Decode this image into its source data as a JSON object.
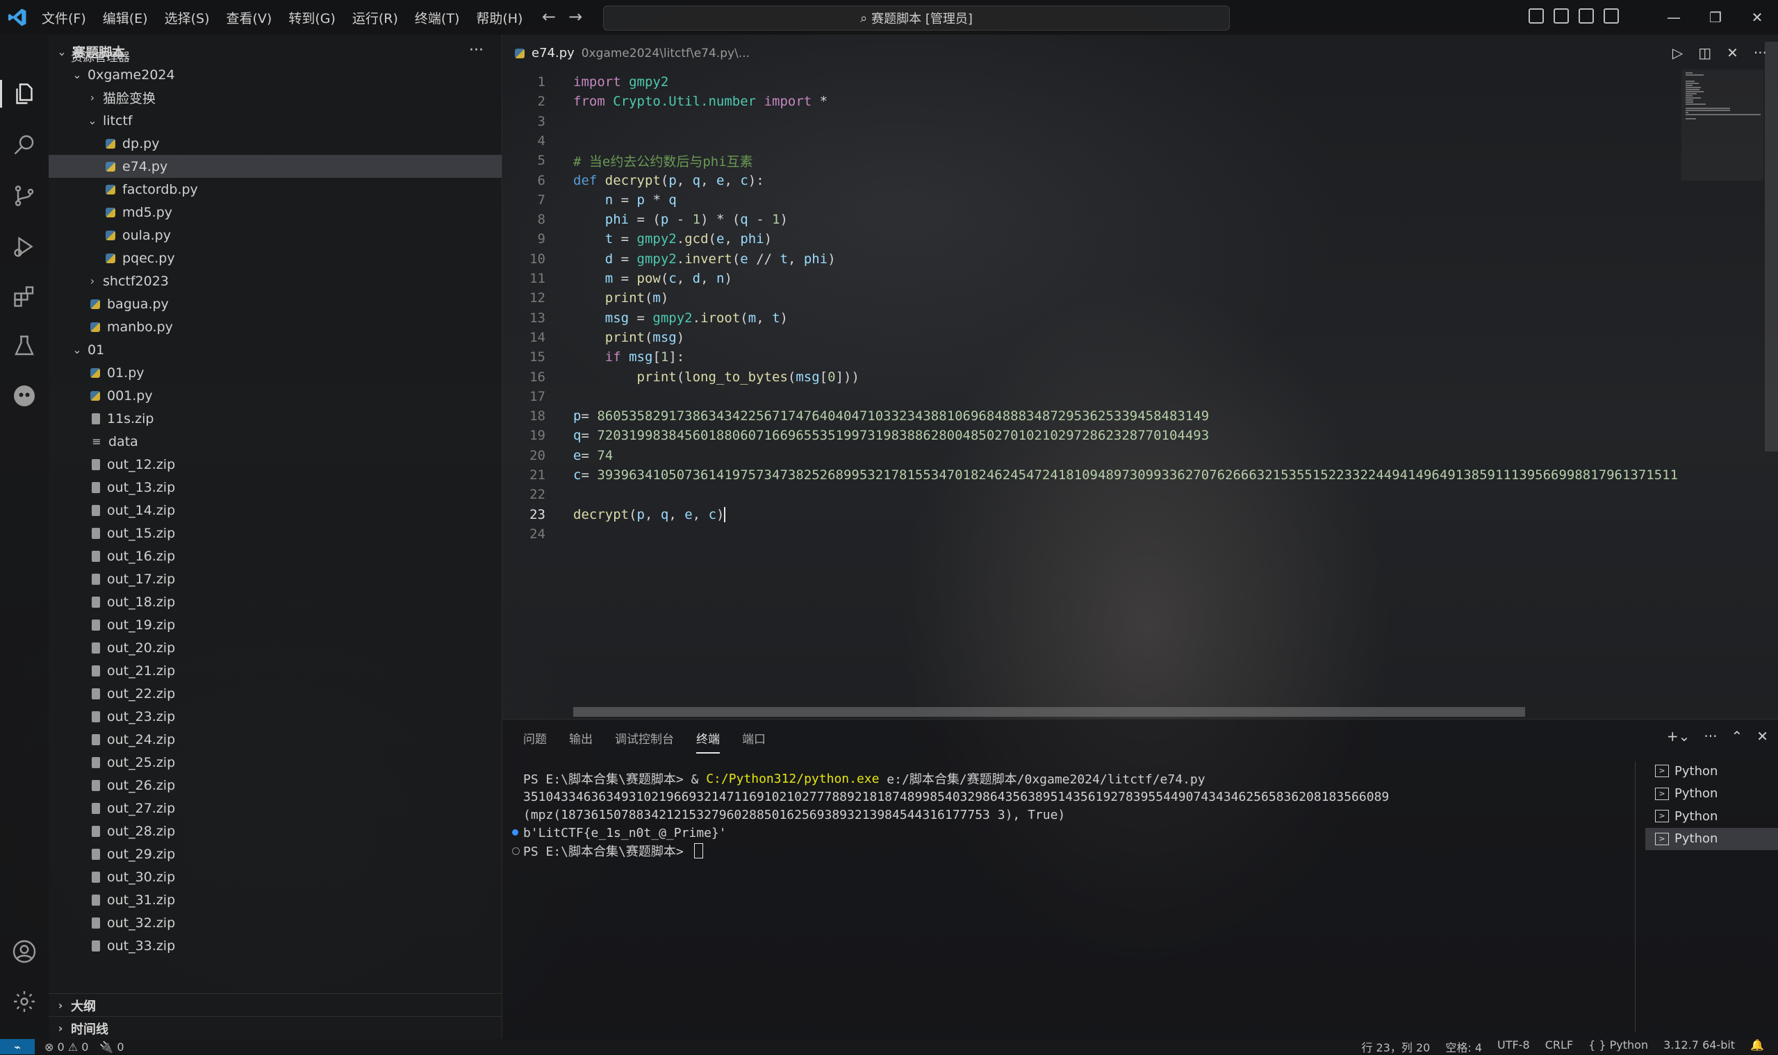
{
  "window": {
    "command_center": "赛题脚本 [管理员]"
  },
  "menu": [
    "文件(F)",
    "编辑(E)",
    "选择(S)",
    "查看(V)",
    "转到(G)",
    "运行(R)",
    "终端(T)",
    "帮助(H)"
  ],
  "sidebar": {
    "title": "资源管理器",
    "more": "···",
    "tree": [
      {
        "label": "赛题脚本",
        "level": 0,
        "type": "folder-open",
        "bold": true
      },
      {
        "label": "0xgame2024",
        "level": 1,
        "type": "folder-open"
      },
      {
        "label": "猫脸变换",
        "level": 2,
        "type": "folder-closed"
      },
      {
        "label": "litctf",
        "level": 2,
        "type": "folder-open"
      },
      {
        "label": "dp.py",
        "level": 3,
        "type": "py"
      },
      {
        "label": "e74.py",
        "level": 3,
        "type": "py",
        "selected": true
      },
      {
        "label": "factordb.py",
        "level": 3,
        "type": "py"
      },
      {
        "label": "md5.py",
        "level": 3,
        "type": "py"
      },
      {
        "label": "oula.py",
        "level": 3,
        "type": "py"
      },
      {
        "label": "pqec.py",
        "level": 3,
        "type": "py"
      },
      {
        "label": "shctf2023",
        "level": 2,
        "type": "folder-closed"
      },
      {
        "label": "bagua.py",
        "level": 2,
        "type": "py"
      },
      {
        "label": "manbo.py",
        "level": 2,
        "type": "py"
      },
      {
        "label": "01",
        "level": 1,
        "type": "folder-open"
      },
      {
        "label": "01.py",
        "level": 2,
        "type": "py"
      },
      {
        "label": "001.py",
        "level": 2,
        "type": "py"
      },
      {
        "label": "11s.zip",
        "level": 2,
        "type": "zip"
      },
      {
        "label": "data",
        "level": 2,
        "type": "txt"
      },
      {
        "label": "out_12.zip",
        "level": 2,
        "type": "zip"
      },
      {
        "label": "out_13.zip",
        "level": 2,
        "type": "zip"
      },
      {
        "label": "out_14.zip",
        "level": 2,
        "type": "zip"
      },
      {
        "label": "out_15.zip",
        "level": 2,
        "type": "zip"
      },
      {
        "label": "out_16.zip",
        "level": 2,
        "type": "zip"
      },
      {
        "label": "out_17.zip",
        "level": 2,
        "type": "zip"
      },
      {
        "label": "out_18.zip",
        "level": 2,
        "type": "zip"
      },
      {
        "label": "out_19.zip",
        "level": 2,
        "type": "zip"
      },
      {
        "label": "out_20.zip",
        "level": 2,
        "type": "zip"
      },
      {
        "label": "out_21.zip",
        "level": 2,
        "type": "zip"
      },
      {
        "label": "out_22.zip",
        "level": 2,
        "type": "zip"
      },
      {
        "label": "out_23.zip",
        "level": 2,
        "type": "zip"
      },
      {
        "label": "out_24.zip",
        "level": 2,
        "type": "zip"
      },
      {
        "label": "out_25.zip",
        "level": 2,
        "type": "zip"
      },
      {
        "label": "out_26.zip",
        "level": 2,
        "type": "zip"
      },
      {
        "label": "out_27.zip",
        "level": 2,
        "type": "zip"
      },
      {
        "label": "out_28.zip",
        "level": 2,
        "type": "zip"
      },
      {
        "label": "out_29.zip",
        "level": 2,
        "type": "zip"
      },
      {
        "label": "out_30.zip",
        "level": 2,
        "type": "zip"
      },
      {
        "label": "out_31.zip",
        "level": 2,
        "type": "zip"
      },
      {
        "label": "out_32.zip",
        "level": 2,
        "type": "zip"
      },
      {
        "label": "out_33.zip",
        "level": 2,
        "type": "zip"
      }
    ],
    "outline": "大纲",
    "timeline": "时间线"
  },
  "editor": {
    "tab_name": "e74.py",
    "tab_path": "0xgame2024\\litctf\\e74.py\\...",
    "current_line": 23,
    "lines": [
      [
        [
          "kw",
          "import"
        ],
        [
          "pl",
          " "
        ],
        [
          "mod",
          "gmpy2"
        ]
      ],
      [
        [
          "kw",
          "from"
        ],
        [
          "pl",
          " "
        ],
        [
          "mod",
          "Crypto.Util.number"
        ],
        [
          "pl",
          " "
        ],
        [
          "kw",
          "import"
        ],
        [
          "pl",
          " *"
        ]
      ],
      [],
      [],
      [
        [
          "cm",
          "# 当e约去公约数后与phi互素"
        ]
      ],
      [
        [
          "kw2",
          "def"
        ],
        [
          "pl",
          " "
        ],
        [
          "fn",
          "decrypt"
        ],
        [
          "pl",
          "("
        ],
        [
          "var",
          "p"
        ],
        [
          "pl",
          ", "
        ],
        [
          "var",
          "q"
        ],
        [
          "pl",
          ", "
        ],
        [
          "var",
          "e"
        ],
        [
          "pl",
          ", "
        ],
        [
          "var",
          "c"
        ],
        [
          "pl",
          "):"
        ]
      ],
      [
        [
          "pl",
          "    "
        ],
        [
          "var",
          "n"
        ],
        [
          "pl",
          " = "
        ],
        [
          "var",
          "p"
        ],
        [
          "pl",
          " * "
        ],
        [
          "var",
          "q"
        ]
      ],
      [
        [
          "pl",
          "    "
        ],
        [
          "var",
          "phi"
        ],
        [
          "pl",
          " = ("
        ],
        [
          "var",
          "p"
        ],
        [
          "pl",
          " - "
        ],
        [
          "num",
          "1"
        ],
        [
          "pl",
          ") * ("
        ],
        [
          "var",
          "q"
        ],
        [
          "pl",
          " - "
        ],
        [
          "num",
          "1"
        ],
        [
          "pl",
          ")"
        ]
      ],
      [
        [
          "pl",
          "    "
        ],
        [
          "var",
          "t"
        ],
        [
          "pl",
          " = "
        ],
        [
          "mod",
          "gmpy2"
        ],
        [
          "pl",
          "."
        ],
        [
          "fn",
          "gcd"
        ],
        [
          "pl",
          "("
        ],
        [
          "var",
          "e"
        ],
        [
          "pl",
          ", "
        ],
        [
          "var",
          "phi"
        ],
        [
          "pl",
          ")"
        ]
      ],
      [
        [
          "pl",
          "    "
        ],
        [
          "var",
          "d"
        ],
        [
          "pl",
          " = "
        ],
        [
          "mod",
          "gmpy2"
        ],
        [
          "pl",
          "."
        ],
        [
          "fn",
          "invert"
        ],
        [
          "pl",
          "("
        ],
        [
          "var",
          "e"
        ],
        [
          "pl",
          " // "
        ],
        [
          "var",
          "t"
        ],
        [
          "pl",
          ", "
        ],
        [
          "var",
          "phi"
        ],
        [
          "pl",
          ")"
        ]
      ],
      [
        [
          "pl",
          "    "
        ],
        [
          "var",
          "m"
        ],
        [
          "pl",
          " = "
        ],
        [
          "fn",
          "pow"
        ],
        [
          "pl",
          "("
        ],
        [
          "var",
          "c"
        ],
        [
          "pl",
          ", "
        ],
        [
          "var",
          "d"
        ],
        [
          "pl",
          ", "
        ],
        [
          "var",
          "n"
        ],
        [
          "pl",
          ")"
        ]
      ],
      [
        [
          "pl",
          "    "
        ],
        [
          "fn",
          "print"
        ],
        [
          "pl",
          "("
        ],
        [
          "var",
          "m"
        ],
        [
          "pl",
          ")"
        ]
      ],
      [
        [
          "pl",
          "    "
        ],
        [
          "var",
          "msg"
        ],
        [
          "pl",
          " = "
        ],
        [
          "mod",
          "gmpy2"
        ],
        [
          "pl",
          "."
        ],
        [
          "fn",
          "iroot"
        ],
        [
          "pl",
          "("
        ],
        [
          "var",
          "m"
        ],
        [
          "pl",
          ", "
        ],
        [
          "var",
          "t"
        ],
        [
          "pl",
          ")"
        ]
      ],
      [
        [
          "pl",
          "    "
        ],
        [
          "fn",
          "print"
        ],
        [
          "pl",
          "("
        ],
        [
          "var",
          "msg"
        ],
        [
          "pl",
          ")"
        ]
      ],
      [
        [
          "pl",
          "    "
        ],
        [
          "kw",
          "if"
        ],
        [
          "pl",
          " "
        ],
        [
          "var",
          "msg"
        ],
        [
          "pl",
          "["
        ],
        [
          "num",
          "1"
        ],
        [
          "pl",
          "]:"
        ]
      ],
      [
        [
          "pl",
          "        "
        ],
        [
          "fn",
          "print"
        ],
        [
          "pl",
          "("
        ],
        [
          "fn",
          "long_to_bytes"
        ],
        [
          "pl",
          "("
        ],
        [
          "var",
          "msg"
        ],
        [
          "pl",
          "["
        ],
        [
          "num",
          "0"
        ],
        [
          "pl",
          "]))"
        ]
      ],
      [],
      [
        [
          "var",
          "p"
        ],
        [
          "pl",
          "= "
        ],
        [
          "num",
          "86053582917386343422567174764040471033234388106968488834872953625339458483149"
        ]
      ],
      [
        [
          "var",
          "q"
        ],
        [
          "pl",
          "= "
        ],
        [
          "num",
          "72031998384560188060716696553519973198388628004850270102102972862328770104493"
        ]
      ],
      [
        [
          "var",
          "e"
        ],
        [
          "pl",
          "= "
        ],
        [
          "num",
          "74"
        ]
      ],
      [
        [
          "var",
          "c"
        ],
        [
          "pl",
          "= "
        ],
        [
          "num",
          "3939634105073614197573473825268995321781553470182462454724181094897309933627076266632153551522332244941496491385911139566998817961371511"
        ]
      ],
      [],
      [
        [
          "fn",
          "decrypt"
        ],
        [
          "pl",
          "("
        ],
        [
          "var",
          "p"
        ],
        [
          "pl",
          ", "
        ],
        [
          "var",
          "q"
        ],
        [
          "pl",
          ", "
        ],
        [
          "var",
          "e"
        ],
        [
          "pl",
          ", "
        ],
        [
          "var",
          "c"
        ],
        [
          "pl",
          ")"
        ]
      ],
      []
    ]
  },
  "panel": {
    "tabs": [
      {
        "label": "问题",
        "active": false
      },
      {
        "label": "输出",
        "active": false
      },
      {
        "label": "调试控制台",
        "active": false
      },
      {
        "label": "终端",
        "active": true
      },
      {
        "label": "端口",
        "active": false
      }
    ],
    "terminal": {
      "line1_prompt": "PS E:\\脚本合集\\赛题脚本> & ",
      "line1_exe": "C:/Python312/python.exe",
      "line1_arg": " e:/脚本合集/赛题脚本/0xgame2024/litctf/e74.py",
      "line2": "3510433463634931021966932147116910210277788921818748998540329864356389514356192783955449074343462565836208183566089",
      "line3": "(mpz(187361507883421215327960288501625693893213984544316177753 3), True)",
      "line4": "b'LitCTF{e_1s_n0t_@_Prime}'",
      "line5": "PS E:\\脚本合集\\赛题脚本> "
    },
    "terminal_list": [
      "Python",
      "Python",
      "Python",
      "Python"
    ]
  },
  "statusbar": {
    "errors": "⊗ 0 ⚠ 0",
    "ports": "🔌 0",
    "position": "行 23，列 20",
    "spaces": "空格: 4",
    "encoding": "UTF-8",
    "eol": "CRLF",
    "language": "{ } Python",
    "interpreter": "3.12.7 64-bit"
  },
  "colors": {
    "accent": "#0e639c"
  }
}
